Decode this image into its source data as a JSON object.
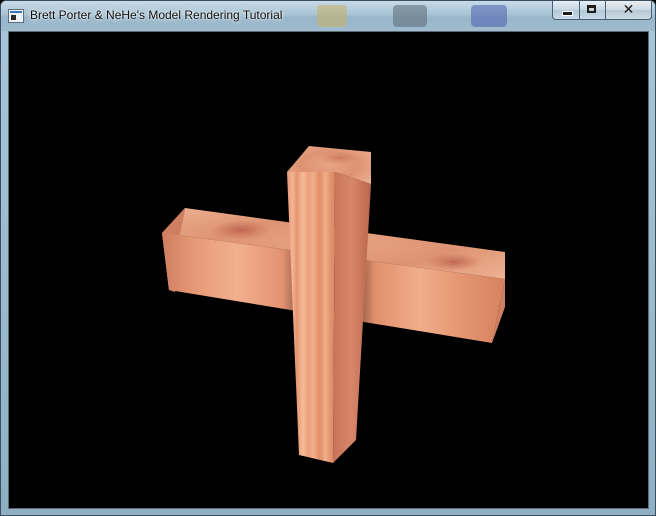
{
  "window": {
    "title": "Brett Porter & NeHe's Model Rendering Tutorial",
    "icon": "app-window-icon"
  },
  "caption_buttons": {
    "minimize_icon": "minimize-icon",
    "maximize_icon": "maximize-icon",
    "close_icon": "close-icon",
    "close_glyph": "✕"
  },
  "colors": {
    "viewport_background": "#000000",
    "model_light": "#f0b08c",
    "model_mid": "#e79a76",
    "model_dark": "#c47356",
    "model_shadow": "#a65c45"
  }
}
